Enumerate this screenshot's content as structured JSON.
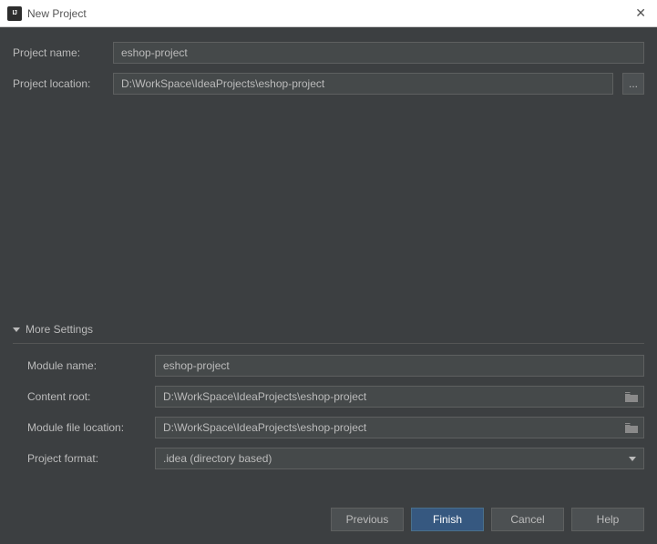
{
  "titlebar": {
    "title": "New Project"
  },
  "top": {
    "project_name_label": "Project name:",
    "project_name_value": "eshop-project",
    "project_location_label": "Project location:",
    "project_location_value": "D:\\WorkSpace\\IdeaProjects\\eshop-project",
    "browse_label": "..."
  },
  "more": {
    "header": "More Settings",
    "module_name_label": "Module name:",
    "module_name_value": "eshop-project",
    "content_root_label": "Content root:",
    "content_root_value": "D:\\WorkSpace\\IdeaProjects\\eshop-project",
    "module_file_location_label": "Module file location:",
    "module_file_location_value": "D:\\WorkSpace\\IdeaProjects\\eshop-project",
    "project_format_label": "Project format:",
    "project_format_value": ".idea (directory based)"
  },
  "buttons": {
    "previous": "Previous",
    "finish": "Finish",
    "cancel": "Cancel",
    "help": "Help"
  }
}
